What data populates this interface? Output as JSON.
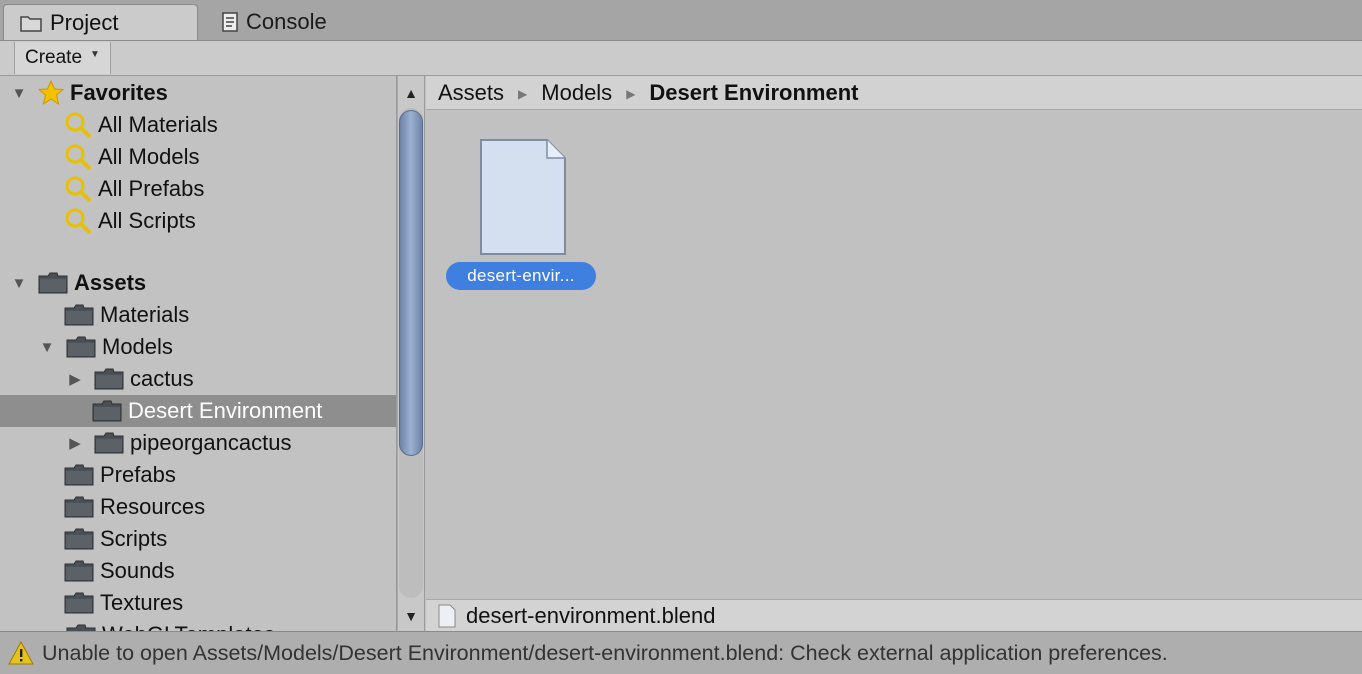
{
  "tabs": [
    {
      "label": "Project",
      "icon": "folder-icon",
      "active": true
    },
    {
      "label": "Console",
      "icon": "console-icon",
      "active": false
    }
  ],
  "toolbar": {
    "create_label": "Create"
  },
  "favorites": {
    "label": "Favorites",
    "items": [
      {
        "label": "All Materials"
      },
      {
        "label": "All Models"
      },
      {
        "label": "All Prefabs"
      },
      {
        "label": "All Scripts"
      }
    ]
  },
  "assets": {
    "label": "Assets",
    "items": [
      {
        "label": "Materials"
      },
      {
        "label": "Models"
      },
      {
        "label": "cactus"
      },
      {
        "label": "Desert Environment"
      },
      {
        "label": "pipeorgancactus"
      },
      {
        "label": "Prefabs"
      },
      {
        "label": "Resources"
      },
      {
        "label": "Scripts"
      },
      {
        "label": "Sounds"
      },
      {
        "label": "Textures"
      },
      {
        "label": "WebGLTemplates"
      }
    ]
  },
  "breadcrumb": [
    "Assets",
    "Models",
    "Desert Environment"
  ],
  "asset_tile": {
    "label": "desert-envir..."
  },
  "selected_file": "desert-environment.blend",
  "status_message": "Unable to open Assets/Models/Desert Environment/desert-environment.blend: Check external application preferences.",
  "colors": {
    "selection": "#3f7fe0",
    "tree_selected": "#8e8e8e",
    "warning": "#e8c21c",
    "favorite_star": "#f2c200"
  }
}
